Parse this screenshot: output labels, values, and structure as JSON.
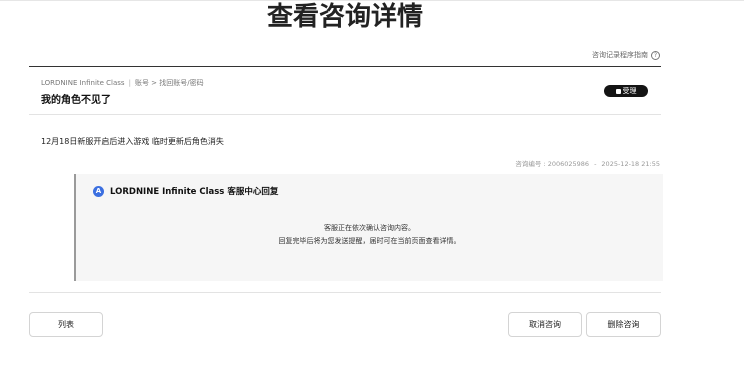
{
  "page_title": "查看咨询详情",
  "guide_link": {
    "label": "咨询记录程序指南",
    "icon": "?"
  },
  "breadcrumb": {
    "game": "LORDNINE Infinite Class",
    "path": "账号 > 找回账号/密码"
  },
  "inquiry": {
    "title": "我的角色不见了",
    "status": "受理",
    "content": "12月18日新服开启后进入游戏 临时更新后角色消失",
    "inquiry_number_label": "咨询编号 : 2006025986",
    "datetime": "2025-12-18 21:55",
    "meta_separator": "-"
  },
  "reply": {
    "avatar_letter": "A",
    "title": "LORDNINE Infinite Class 客服中心回复",
    "line1": "客服正在依次确认咨询内容。",
    "line2": "回复完毕后将为您发送提醒，届时可在当前页面查看详情。"
  },
  "buttons": {
    "list": "列表",
    "cancel": "取消咨询",
    "delete": "删除咨询"
  },
  "colors": {
    "badge_bg": "#141414",
    "avatar_bg": "#3b6fe0",
    "reply_bg": "#f6f6f6"
  }
}
